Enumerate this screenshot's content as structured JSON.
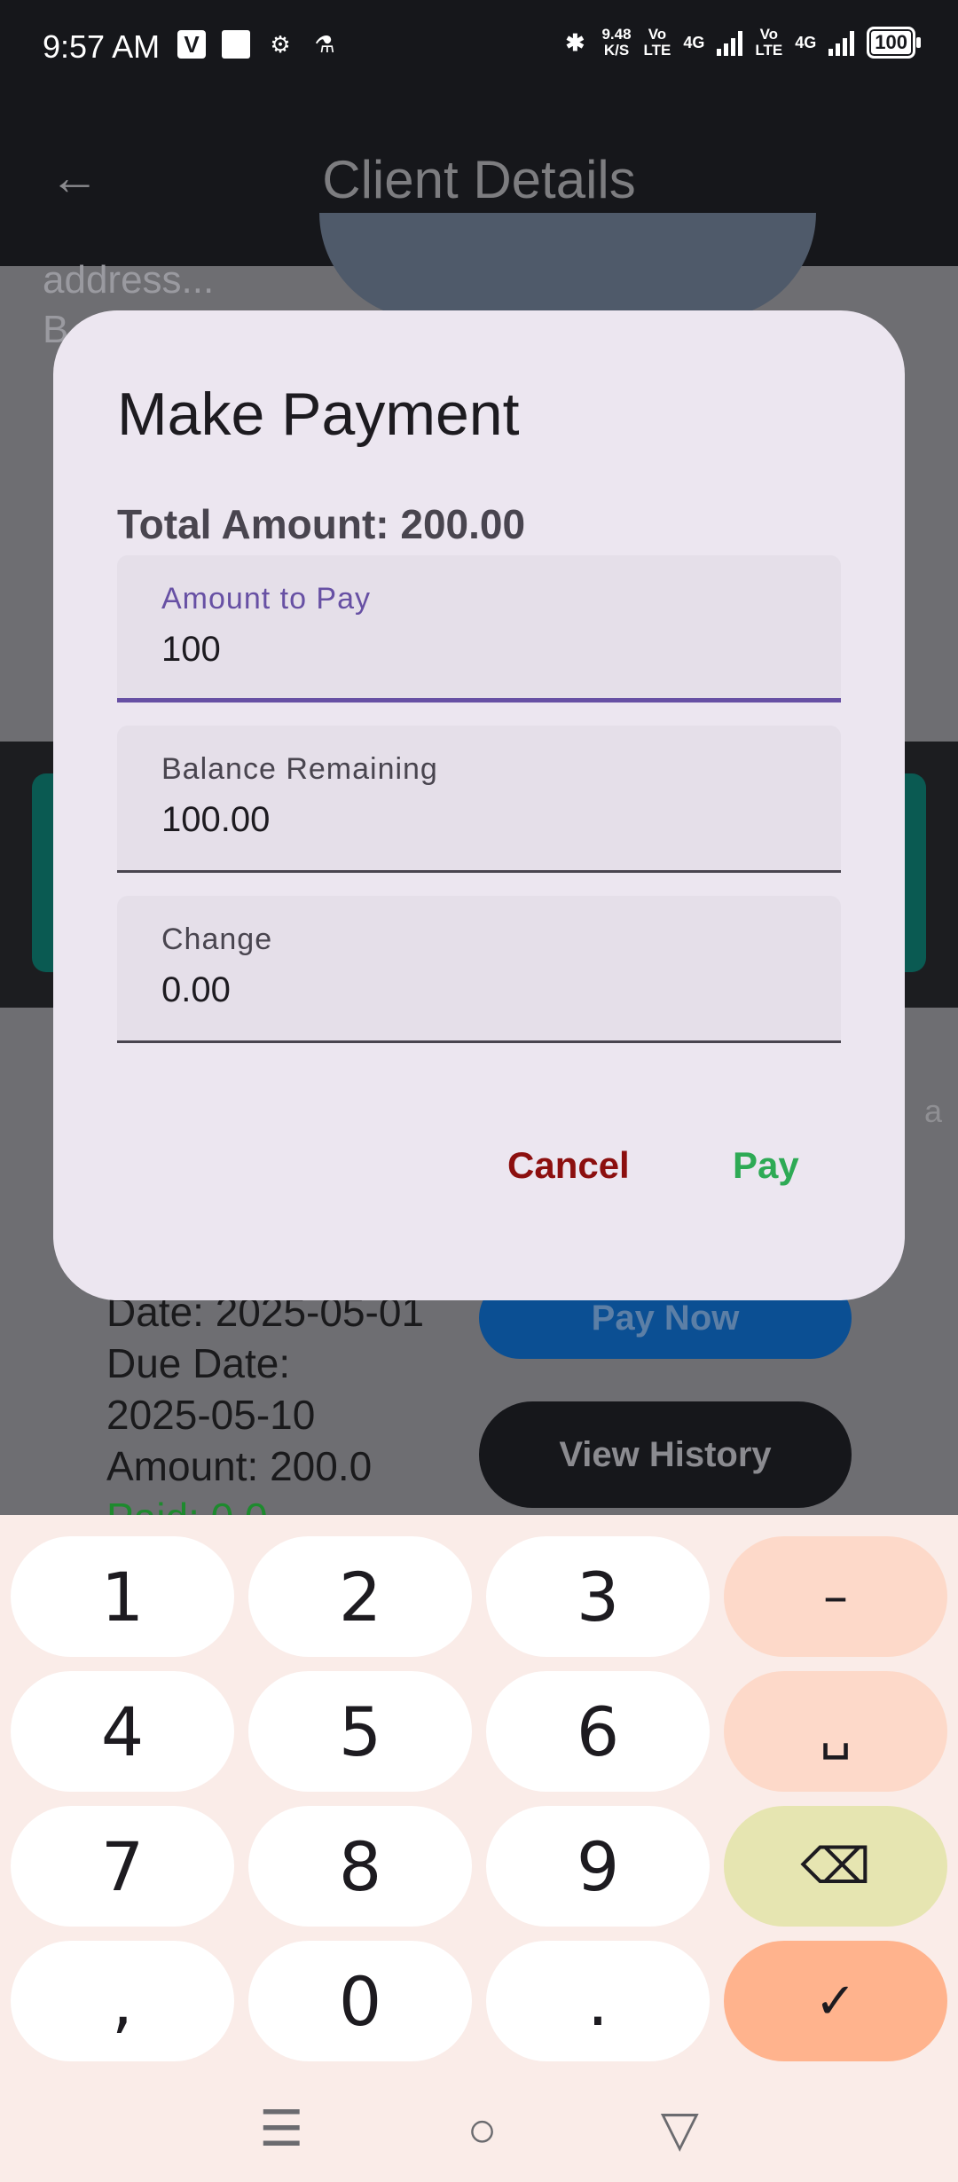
{
  "status_bar": {
    "time": "9:57 AM",
    "net_speed_value": "9.48",
    "net_speed_unit": "K/S",
    "vo1": "Vo",
    "lte1": "LTE",
    "net1": "4G",
    "vo2": "Vo",
    "lte2": "LTE",
    "net2": "4G",
    "battery": "100"
  },
  "app_bar": {
    "title": "Client Details",
    "back_icon": "arrow-back-icon"
  },
  "background": {
    "address_line1": "address...",
    "address_line2": "B",
    "side_letter": "a",
    "info_date": "Date: 2025-05-01",
    "info_due_label": "Due Date:",
    "info_due_value": "2025-05-10",
    "info_amount": "Amount: 200.0",
    "info_paid": "Paid: 0.0",
    "pay_now_label": "Pay Now",
    "view_history_label": "View History"
  },
  "dialog": {
    "title": "Make Payment",
    "total": "Total Amount: 200.00",
    "fields": [
      {
        "label": "Amount to Pay",
        "value": "100"
      },
      {
        "label": "Balance Remaining",
        "value": "100.00"
      },
      {
        "label": "Change",
        "value": "0.00"
      }
    ],
    "cancel_label": "Cancel",
    "pay_label": "Pay"
  },
  "keyboard": {
    "keys": [
      "1",
      "2",
      "3",
      "–",
      "4",
      "5",
      "6",
      "␣",
      "7",
      "8",
      "9",
      "⌫",
      ",",
      "0",
      ".",
      "✓"
    ]
  },
  "colors": {
    "accent": "#6750a4",
    "cancel": "#8c0f0f",
    "pay": "#2eaa55"
  }
}
